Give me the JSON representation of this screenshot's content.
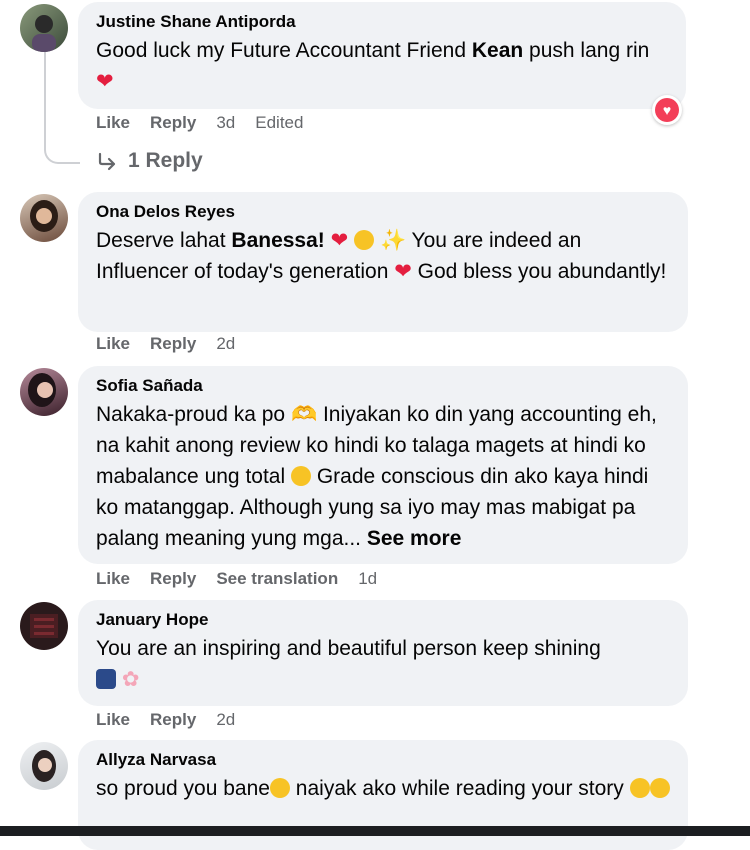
{
  "comments": [
    {
      "author": "Justine Shane Antiporda",
      "text_before": "Good luck my Future Accountant Friend ",
      "text_bold": "Kean",
      "text_after": " push lang rin",
      "actions": [
        "Like",
        "Reply"
      ],
      "time": "3d",
      "edited": "Edited",
      "replies": "1 Reply"
    },
    {
      "author": "Ona Delos Reyes",
      "text_before": "Deserve lahat ",
      "text_bold": "Banessa!",
      "text_mid": " You are indeed an Influencer of today's generation",
      "text_after": " God bless you abundantly!",
      "actions": [
        "Like",
        "Reply"
      ],
      "time": "2d"
    },
    {
      "author": "Sofia Sañada",
      "text_a": "Nakaka-proud ka po",
      "text_b": " Iniyakan ko din yang accounting eh, na kahit anong review ko hindi ko talaga magets at hindi ko mabalance ung total",
      "text_c": " Grade conscious din ako kaya hindi ko matanggap. Although yung sa iyo may mas mabigat pa palang meaning yung mga...",
      "see_more": "See more",
      "actions": [
        "Like",
        "Reply",
        "See translation"
      ],
      "time": "1d"
    },
    {
      "author": "January Hope",
      "text": "You are an inspiring and beautiful person keep shining",
      "actions": [
        "Like",
        "Reply"
      ],
      "time": "2d"
    },
    {
      "author": "Allyza Narvasa",
      "text_a": "so proud you bane",
      "text_b": " naiyak ako while reading your story"
    }
  ],
  "colors": {
    "bubble": "#f0f2f5",
    "meta": "#65676b",
    "love": "#f33e58"
  }
}
